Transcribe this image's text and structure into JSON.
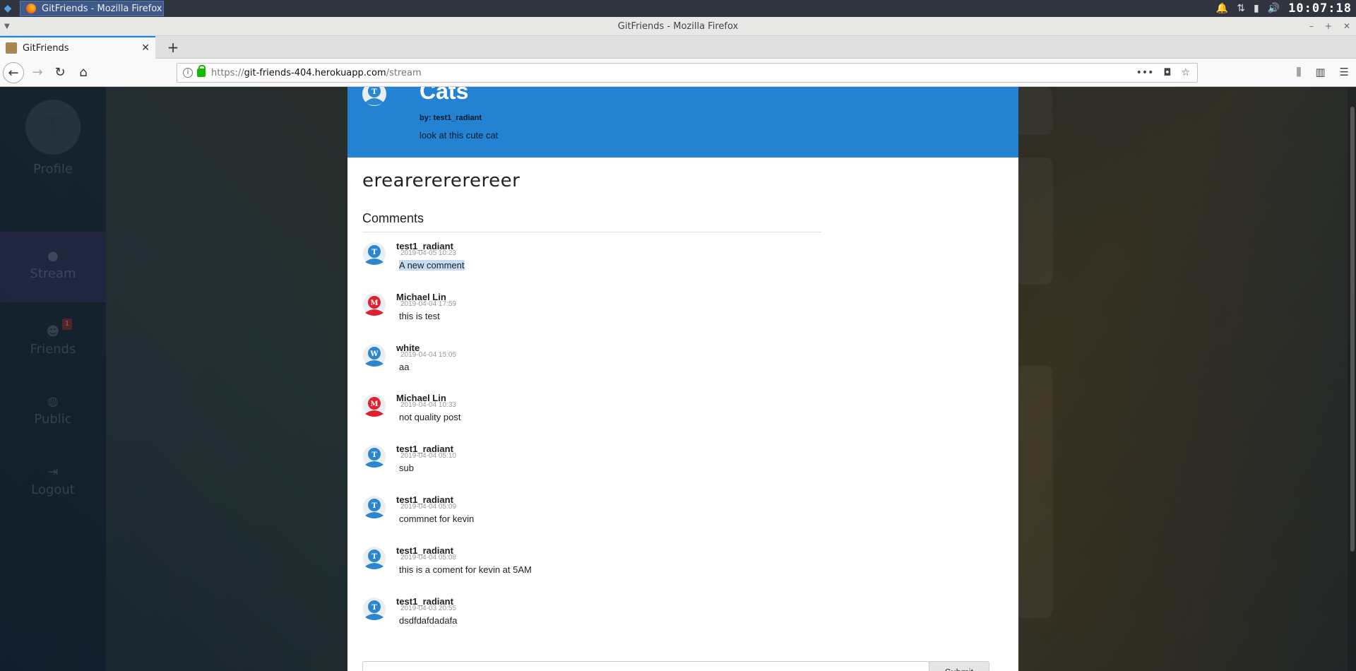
{
  "os": {
    "task_title": "GitFriends - Mozilla Firefox",
    "clock": "10:07:18"
  },
  "window": {
    "title": "GitFriends - Mozilla Firefox"
  },
  "tab": {
    "label": "GitFriends"
  },
  "urlbar": {
    "scheme": "https://",
    "host": "git-friends-404.herokuapp.com",
    "path": "/stream"
  },
  "sidebar": {
    "avatar_letter": "T",
    "items": [
      {
        "label": "Profile",
        "icon": "user-icon"
      },
      {
        "label": "Stream",
        "icon": "drop-icon"
      },
      {
        "label": "Friends",
        "icon": "users-icon",
        "badge": "1"
      },
      {
        "label": "Public",
        "icon": "globe-icon"
      },
      {
        "label": "Logout",
        "icon": "logout-icon"
      }
    ]
  },
  "post": {
    "title": "Cats",
    "author_line": "by: test1_radiant",
    "body": "look at this cute cat",
    "content": "erearerererereer",
    "avatar_letter": "T",
    "header_color": "#2383d2"
  },
  "comments": {
    "heading": "Comments",
    "items": [
      {
        "author": "test1_radiant",
        "date": "2019-04-05 10:23",
        "text": "A new comment",
        "avatar": "T",
        "color": "#2a86d0"
      },
      {
        "author": "Michael Lin",
        "date": "2019-04-04 17:59",
        "text": "this is test",
        "avatar": "M",
        "color": "#e0202e"
      },
      {
        "author": "white",
        "date": "2019-04-04 15:05",
        "text": "aa",
        "avatar": "W",
        "color": "#2a86d0"
      },
      {
        "author": "Michael Lin",
        "date": "2019-04-04 10:33",
        "text": "not quality post",
        "avatar": "M",
        "color": "#e0202e"
      },
      {
        "author": "test1_radiant",
        "date": "2019-04-04 05:10",
        "text": "sub",
        "avatar": "T",
        "color": "#2a86d0"
      },
      {
        "author": "test1_radiant",
        "date": "2019-04-04 05:09",
        "text": "commnet for kevin",
        "avatar": "T",
        "color": "#2a86d0"
      },
      {
        "author": "test1_radiant",
        "date": "2019-04-04 05:08",
        "text": "this is a coment for kevin at 5AM",
        "avatar": "T",
        "color": "#2a86d0"
      },
      {
        "author": "test1_radiant",
        "date": "2019-04-03 20:55",
        "text": "dsdfdafdadafa",
        "avatar": "T",
        "color": "#2a86d0"
      }
    ],
    "input_placeholder": "",
    "submit_label": "Submit"
  }
}
